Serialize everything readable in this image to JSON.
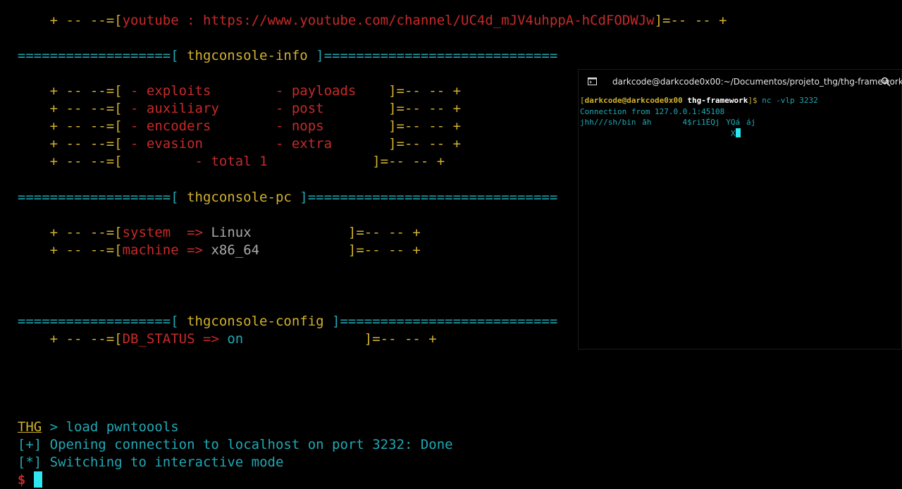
{
  "top_line": {
    "pre": "    + -- --=[",
    "label": "youtube : https://www.youtube.com/channel/UC4d_mJV4uhppA-hCdFODWJw",
    "post": "]=-- -- +"
  },
  "info": {
    "header_left": "===================[",
    "header_title": " thgconsole-info ",
    "header_right": "]=============================",
    "rows": [
      {
        "pre": "    + -- --=[",
        "a": " - exploits        ",
        "b": "- payloads   ",
        "post": " ]=-- -- +"
      },
      {
        "pre": "    + -- --=[",
        "a": " - auxiliary       ",
        "b": "- post       ",
        "post": " ]=-- -- +"
      },
      {
        "pre": "    + -- --=[",
        "a": " - encoders        ",
        "b": "- nops       ",
        "post": " ]=-- -- +"
      },
      {
        "pre": "    + -- --=[",
        "a": " - evasion         ",
        "b": "- extra      ",
        "post": " ]=-- -- +"
      }
    ],
    "total_pre": "    + -- --=[",
    "total_label": "         - total 1            ",
    "total_post": " ]=-- -- +"
  },
  "pc": {
    "header_left": "===================[",
    "header_title": " thgconsole-pc ",
    "header_right": "]===============================",
    "rows": [
      {
        "pre": "    + -- --=[",
        "key": "system  => ",
        "val": "Linux           ",
        "post": " ]=-- -- +"
      },
      {
        "pre": "    + -- --=[",
        "key": "machine => ",
        "val": "x86_64          ",
        "post": " ]=-- -- +"
      }
    ]
  },
  "config": {
    "header_left": "===================[",
    "header_title": " thgconsole-config ",
    "header_right": "]===========================",
    "row": {
      "pre": "    + -- --=[",
      "key": "DB_STATUS => ",
      "val": "on              ",
      "post": " ]=-- -- +"
    }
  },
  "prompt": {
    "name": "THG",
    "command": " > load pwntoools",
    "line1_tag": "[+]",
    "line1_text": " Opening connection to localhost on port 3232: Done",
    "line2_tag": "[*]",
    "line2_text": " Switching to interactive mode",
    "shell_symbol": "$ "
  },
  "window": {
    "title": "darkcode@darkcode0x00:~/Documentos/projeto_thg/thg-framework",
    "prompt_open": "[",
    "prompt_user": "darkcode@darkcode0x00",
    "prompt_dir": " thg-framework",
    "prompt_close": "]$",
    "command": " nc -vlp 3232",
    "line2": "Connection from 127.0.0.1:45108",
    "line3": "jhh///sh/binãh\u0001\u0001\u0001\u00014$ri1ÉQj\u0004YQááj",
    "line4": "X"
  },
  "colors": {
    "yellow": "#d1b12f",
    "cyan": "#21a8b4",
    "red": "#c62a2a",
    "gray": "#a9a9a9",
    "cursor": "#2ee6f0"
  }
}
